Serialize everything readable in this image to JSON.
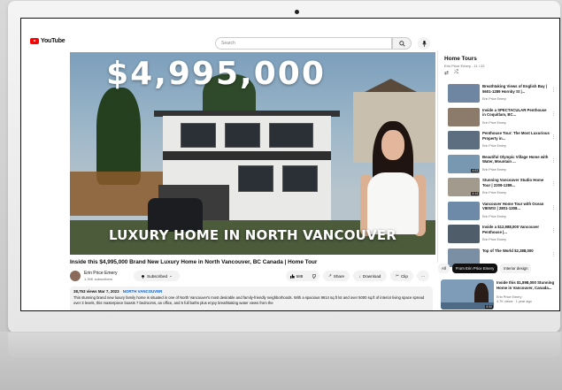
{
  "header": {
    "logo_text": "YouTube",
    "search_placeholder": "Search"
  },
  "video": {
    "overlay_price": "$4,995,000",
    "overlay_caption": "LUXURY HOME IN NORTH VANCOUVER",
    "title": "Inside this $4,995,000 Brand New Luxury Home in North Vancouver, BC Canada | Home Tour"
  },
  "channel": {
    "name": "Erin Price Emery",
    "subscribers": "1.39K subscribers",
    "subscribe_label": "Subscribed",
    "likes": "588",
    "share_label": "Share",
    "download_label": "Download",
    "clip_label": "Clip",
    "more_label": "···"
  },
  "description": {
    "views": "38,753 views",
    "date": "Mar 7, 2023",
    "tag": "NORTH VANCOUVER",
    "text": "This stunning brand new luxury family home is situated in one of North Vancouver's most desirable and family-friendly neighborhoods. With a spacious 9614 sq.ft lot and over 5000 sq.ft of interior living space spread over 3 levels, this masterpiece boasts 7 bedrooms, an office, and 5 full baths plus enjoy breathtaking water views from the"
  },
  "playlist": {
    "title": "Home Tours",
    "subtitle": "Erin Price Emery - 11 / 22",
    "items": [
      {
        "title": "Breathtaking Views of English Bay | 5601-1289 Hornby St |...",
        "channel": "Erin Price Emery",
        "duration": "",
        "color": "#6f86a2"
      },
      {
        "title": "Inside a SPECTACULAR Penthouse in Coquitlam, BC...",
        "channel": "Erin Price Emery",
        "duration": "",
        "color": "#8c7b6b"
      },
      {
        "title": "Penthouse Tour: The Most Luxurious Property in...",
        "channel": "Erin Price Emery",
        "duration": "",
        "color": "#5c6e80"
      },
      {
        "title": "Beautiful Olympic Village Home with Water, Mountain ...",
        "channel": "Erin Price Emery",
        "duration": "4:03",
        "color": "#7897b0"
      },
      {
        "title": "Stunning Vancouver Studio Home Tour | 2209-1289...",
        "channel": "Erin Price Emery",
        "duration": "4:14",
        "color": "#a39a8e"
      },
      {
        "title": "Vancouver Home Tour with Ocean VIEWS! | 2801-1308...",
        "channel": "Erin Price Emery",
        "duration": "",
        "color": "#6d8aa8"
      },
      {
        "title": "Inside a $12,988,000 Vancouver Penthouse |...",
        "channel": "Erin Price Emery",
        "duration": "",
        "color": "#4f5d6b"
      },
      {
        "title": "Top of The World $2,388,000",
        "channel": "",
        "duration": "",
        "color": "#7a8fa3"
      }
    ]
  },
  "chips": [
    "All",
    "From Erin Price Emery",
    "Interior design"
  ],
  "recommendation": {
    "title": "Inside this $1,898,000 Stunning Home in Vancouver, Canada...",
    "channel": "Erin Price Emery",
    "meta": "4.7K views · 1 year ago",
    "duration": "8:50"
  },
  "colors": {
    "accent_red": "#ff0000",
    "link_blue": "#065fd4"
  }
}
